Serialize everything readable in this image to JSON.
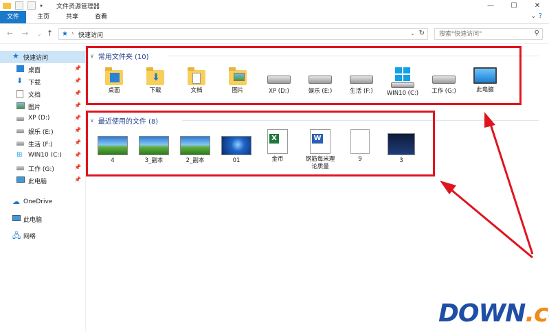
{
  "window": {
    "title": "文件资源管理器",
    "controls": [
      "—",
      "☐",
      "✕"
    ]
  },
  "ribbon": {
    "tabs": [
      "文件",
      "主页",
      "共享",
      "查看"
    ],
    "active_tab": "文件"
  },
  "address": {
    "path": "快速访问",
    "search_placeholder": "搜索\"快速访问\""
  },
  "sidebar": {
    "quick_access": "快速访问",
    "items": [
      {
        "label": "桌面",
        "icon": "desktop-icon"
      },
      {
        "label": "下载",
        "icon": "download-icon"
      },
      {
        "label": "文档",
        "icon": "document-icon"
      },
      {
        "label": "图片",
        "icon": "picture-icon"
      },
      {
        "label": "XP (D:)",
        "icon": "drive-icon"
      },
      {
        "label": "娱乐 (E:)",
        "icon": "drive-icon"
      },
      {
        "label": "生活 (F:)",
        "icon": "drive-icon"
      },
      {
        "label": "WIN10 (C:)",
        "icon": "windows-drive-icon"
      },
      {
        "label": "工作 (G:)",
        "icon": "drive-icon"
      },
      {
        "label": "此电脑",
        "icon": "computer-icon"
      }
    ],
    "onedrive": "OneDrive",
    "this_pc": "此电脑",
    "network": "网络"
  },
  "frequent": {
    "header": "常用文件夹 (10)",
    "items": [
      "桌面",
      "下载",
      "文档",
      "图片",
      "XP (D:)",
      "娱乐 (E:)",
      "生活 (F:)",
      "WIN10 (C:)",
      "工作 (G:)",
      "此电脑"
    ]
  },
  "recent": {
    "header": "最近使用的文件 (8)",
    "items": [
      "4",
      "3_副本",
      "2_副本",
      "01",
      "金币",
      "钢筋每米理论质量",
      "9",
      "3"
    ]
  },
  "watermark": {
    "part1": "DOWN",
    "part2": ".cc"
  },
  "colors": {
    "accent": "#1979ca",
    "annotation": "#e0141e"
  }
}
